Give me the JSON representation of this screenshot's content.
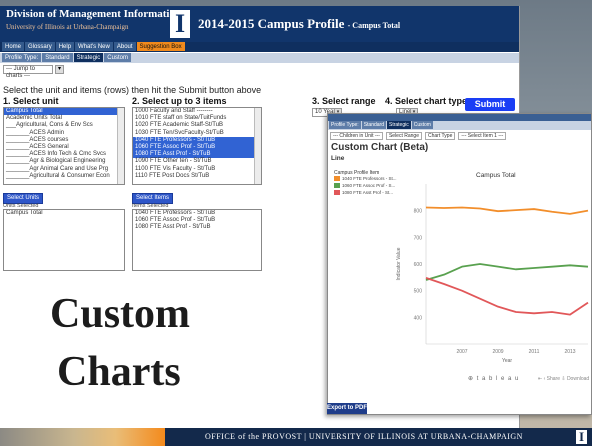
{
  "header": {
    "org_name": "Division of Management Information",
    "org_sub": "University of Illinois at Urbana-Champaign",
    "logo_letter": "I",
    "title": "2014-2015 Campus Profile",
    "title_suffix": "- Campus Total"
  },
  "nav": {
    "items": [
      "Home",
      "Glossary",
      "Help",
      "What's New",
      "About",
      "Suggestion Box"
    ],
    "profile_tabs": [
      "Profile Type:",
      "Standard",
      "Strategic",
      "Custom"
    ],
    "jump_placeholder": "--- Jump to charts ---",
    "jump_go": "▾"
  },
  "form": {
    "instructions": "Select the unit and items (rows) then hit the Submit button above",
    "step1": "1. Select unit",
    "step2": "2. Select up to 3 items",
    "step3": "3. Select range",
    "step4": "4. Select chart type",
    "range_value": "10 Years",
    "chart_type_value": "Line",
    "submit_label": "Submit",
    "units": [
      {
        "label": "Campus Total",
        "selected": true
      },
      {
        "label": "Academic Units Total",
        "selected": false
      },
      {
        "label": "___Agricultural, Cons & Env Scs",
        "selected": false
      },
      {
        "label": "_______ACES Admin",
        "selected": false
      },
      {
        "label": "_______ACES courses",
        "selected": false
      },
      {
        "label": "_______ACES General",
        "selected": false
      },
      {
        "label": "_______ACES Info Tech & Cmc Svcs",
        "selected": false
      },
      {
        "label": "_______Agr & Biological Engineering",
        "selected": false
      },
      {
        "label": "_______Agr Animal Care and Use Prg",
        "selected": false
      },
      {
        "label": "_______Agricultural & Consumer Econ",
        "selected": false
      }
    ],
    "items": [
      {
        "label": "1000 Faculty and Staff --------",
        "selected": false
      },
      {
        "label": "1010 FTE staff on State/TuitFunds",
        "selected": false
      },
      {
        "label": "1020 FTE Academic Staff-St/TuB",
        "selected": false
      },
      {
        "label": "1030 FTE Ten/SvcFaculty-St/TuB",
        "selected": false
      },
      {
        "label": "1040 FTE Professors - St/TuB",
        "selected": true
      },
      {
        "label": "1060 FTE Assoc Prof - St/TuB",
        "selected": true
      },
      {
        "label": "1080 FTE Asst Prof - St/TuB",
        "selected": true
      },
      {
        "label": "1090 FTE Other ten - St/TuB",
        "selected": false
      },
      {
        "label": "1100 FTE Vis Faculty - St/TuB",
        "selected": false
      },
      {
        "label": "1110 FTE Post Docs St/TuB",
        "selected": false
      }
    ],
    "select_units_btn": "Select Units",
    "units_selected_label": "Units Selected",
    "units_selected": [
      "Campus Total"
    ],
    "select_items_btn": "Select Items",
    "items_selected_label": "Items Selected",
    "items_selected": [
      "1040 FTE Professors - St/TuB",
      "1060 FTE Assoc Prof - St/TuB",
      "1080 FTE Asst Prof - St/TuB"
    ]
  },
  "chart_window": {
    "tabs": [
      "Profile Type:",
      "Standard",
      "Strategic",
      "Custom"
    ],
    "controls": [
      "--- Children in Unit ---",
      "Select Range",
      "Chart Type",
      "--- Select Item 1 ---"
    ],
    "title": "Custom Chart (Beta)",
    "subtitle": "Line",
    "legend_title": "Campus Profile Item",
    "legend": [
      {
        "label": "1040 FTE Professors - St...",
        "color": "#f28e2b"
      },
      {
        "label": "1060 FTE Assoc Prof - S...",
        "color": "#59a14f"
      },
      {
        "label": "1080 FTE Asst Prof - St...",
        "color": "#e15759"
      }
    ],
    "tableau_label": "⊕ t a b l e a u",
    "share_label": "⇤  ‹ Share   ⇩ Download",
    "export_label": "Export to PDF"
  },
  "chart_data": {
    "type": "line",
    "title": "Campus Total",
    "xlabel": "Year",
    "ylabel": "Indicator Value",
    "x": [
      2005,
      2006,
      2007,
      2008,
      2009,
      2010,
      2011,
      2012,
      2013,
      2014
    ],
    "xticks": [
      2007,
      2009,
      2011,
      2013
    ],
    "ylim": [
      300,
      900
    ],
    "yticks": [
      400,
      500,
      600,
      700,
      800
    ],
    "series": [
      {
        "name": "1040 FTE Professors - St...",
        "color": "#f28e2b",
        "values": [
          812,
          810,
          812,
          808,
          798,
          802,
          806,
          796,
          788,
          800
        ]
      },
      {
        "name": "1060 FTE Assoc Prof - S...",
        "color": "#59a14f",
        "values": [
          540,
          560,
          590,
          600,
          590,
          580,
          585,
          590,
          595,
          590
        ]
      },
      {
        "name": "1080 FTE Asst Prof - St...",
        "color": "#e15759",
        "values": [
          548,
          525,
          500,
          470,
          440,
          420,
          415,
          420,
          410,
          455
        ]
      }
    ],
    "grid": false,
    "legend_position": "left"
  },
  "overlay": {
    "line1": "Custom",
    "line2": "Charts"
  },
  "footer": {
    "text": "OFFICE of the PROVOST  |  UNIVERSITY OF ILLINOIS AT URBANA-CHAMPAIGN",
    "logo_letter": "I"
  }
}
